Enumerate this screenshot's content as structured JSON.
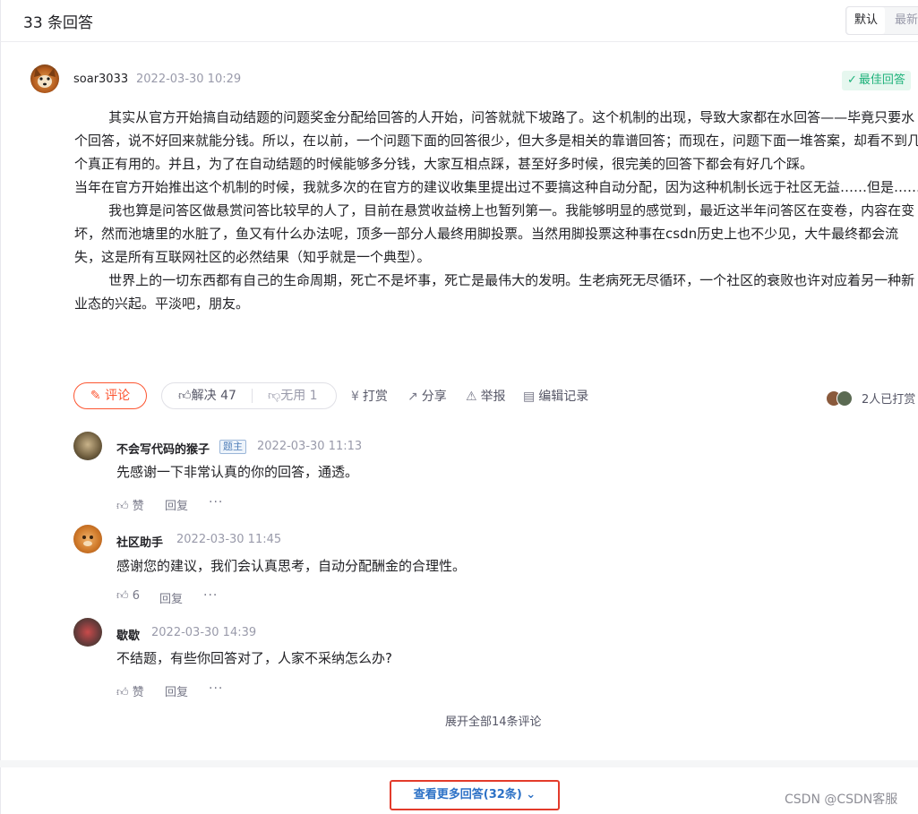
{
  "header": {
    "title": "33 条回答",
    "sort_options": [
      "默认",
      "最新"
    ]
  },
  "answer": {
    "username": "soar3033",
    "time": "2022-03-30 10:29",
    "badge": "最佳回答",
    "paragraphs": [
      "        其实从官方开始搞自动结题的问题奖金分配给回答的人开始，问答就就下坡路了。这个机制的出现，导致大家都在水回答——毕竟只要水个回答，说不好回来就能分钱。所以，在以前，一个问题下面的回答很少，但大多是相关的靠谱回答；而现在，问题下面一堆答案，却看不到几个真正有用的。并且，为了在自动结题的时候能够多分钱，大家互相点踩，甚至好多时候，很完美的回答下都会有好几个踩。",
      "当年在官方开始推出这个机制的时候，我就多次的在官方的建议收集里提出过不要搞这种自动分配，因为这种机制长远于社区无益……但是……",
      "        我也算是问答区做悬赏问答比较早的人了，目前在悬赏收益榜上也暂列第一。我能够明显的感觉到，最近这半年问答区在变卷，内容在变坏，然而池塘里的水脏了，鱼又有什么办法呢，顶多一部分人最终用脚投票。当然用脚投票这种事在csdn历史上也不少见，大牛最终都会流失，这是所有互联网社区的必然结果（知乎就是一个典型）。",
      "        世界上的一切东西都有自己的生命周期，死亡不是坏事，死亡是最伟大的发明。生老病死无尽循环，一个社区的衰败也许对应着另一种新业态的兴起。平淡吧，朋友。"
    ],
    "actions": {
      "comment": "评论",
      "solved": "解决 47",
      "useless": "无用 1",
      "tip": "打赏",
      "share": "分享",
      "report": "举报",
      "edit_history": "编辑记录",
      "tipped_count": "2人已打赏"
    },
    "colors": {
      "accent": "#fc5531",
      "best": "#1fb27b",
      "link": "#2c71c6"
    }
  },
  "comments": [
    {
      "name": "不会写代码的猴子",
      "tag": "题主",
      "time": "2022-03-30 11:13",
      "text": "先感谢一下非常认真的你的回答，通透。",
      "like": "赞",
      "reply": "回复",
      "more": "···"
    },
    {
      "name": "社区助手",
      "tag": "",
      "time": "2022-03-30 11:45",
      "text": "感谢您的建议，我们会认真思考，自动分配酬金的合理性。",
      "like": "6",
      "reply": "回复",
      "more": "···"
    },
    {
      "name": "歇歇",
      "tag": "",
      "time": "2022-03-30 14:39",
      "text": "不结题，有些你回答对了，人家不采纳怎么办?",
      "like": "赞",
      "reply": "回复",
      "more": "···"
    }
  ],
  "expand_comments": "展开全部14条评论",
  "more_answers": "查看更多回答(32条)",
  "watermark": "CSDN @CSDN客服"
}
